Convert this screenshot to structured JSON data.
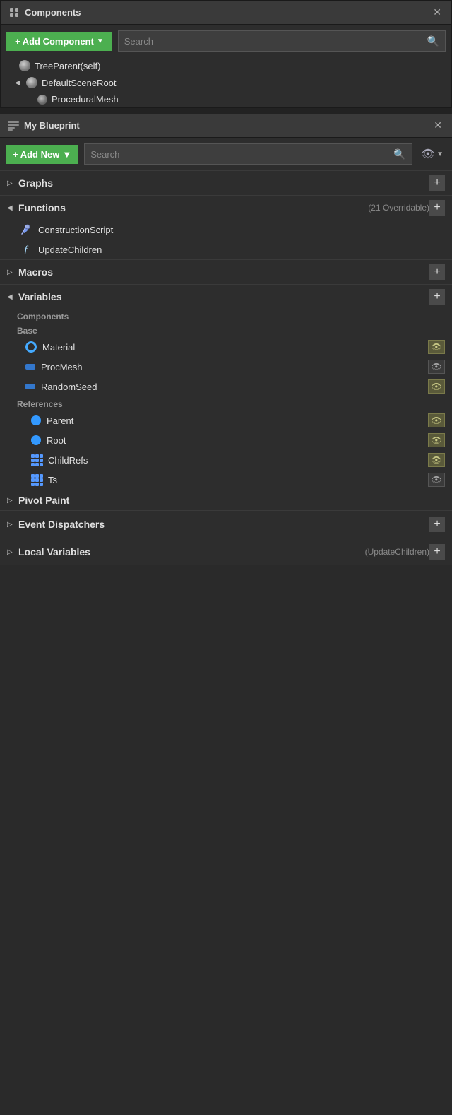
{
  "components_panel": {
    "title": "Components",
    "add_component_label": "+ Add Component",
    "search_placeholder": "Search",
    "tree": [
      {
        "label": "TreeParent(self)",
        "level": 0,
        "has_arrow": false,
        "icon": "sphere"
      },
      {
        "label": "DefaultSceneRoot",
        "level": 1,
        "has_arrow": true,
        "icon": "sphere"
      },
      {
        "label": "ProceduralMesh",
        "level": 2,
        "has_arrow": false,
        "icon": "sphere-small"
      }
    ]
  },
  "blueprint_panel": {
    "title": "My Blueprint",
    "add_new_label": "+ Add New",
    "search_placeholder": "Search",
    "sections": {
      "graphs": {
        "label": "Graphs",
        "expanded": false
      },
      "functions": {
        "label": "Functions",
        "sub": "(21 Overridable)",
        "expanded": true,
        "items": [
          {
            "label": "ConstructionScript",
            "icon": "construct"
          },
          {
            "label": "UpdateChildren",
            "icon": "function"
          }
        ]
      },
      "macros": {
        "label": "Macros",
        "expanded": false
      },
      "variables": {
        "label": "Variables",
        "expanded": true,
        "subsections": {
          "components": {
            "label": "Components",
            "items": []
          },
          "base": {
            "label": "Base",
            "items": [
              {
                "label": "Material",
                "icon": "circle-outline",
                "badge": "eye-visible"
              },
              {
                "label": "ProcMesh",
                "icon": "rect-blue",
                "badge": "eye-hidden"
              },
              {
                "label": "RandomSeed",
                "icon": "rect-blue",
                "badge": "eye-visible"
              }
            ]
          },
          "references": {
            "label": "References",
            "items": [
              {
                "label": "Parent",
                "icon": "dot-blue",
                "badge": "eye-visible"
              },
              {
                "label": "Root",
                "icon": "dot-blue",
                "badge": "eye-visible"
              },
              {
                "label": "ChildRefs",
                "icon": "grid-blue",
                "badge": "eye-visible"
              },
              {
                "label": "Ts",
                "icon": "grid-blue",
                "badge": "eye-hidden"
              }
            ]
          },
          "pivot_paint": {
            "label": "Pivot Paint",
            "items": []
          }
        }
      }
    },
    "event_dispatchers": {
      "label": "Event Dispatchers"
    },
    "local_variables": {
      "label": "Local Variables",
      "sub": "(UpdateChildren)"
    }
  }
}
